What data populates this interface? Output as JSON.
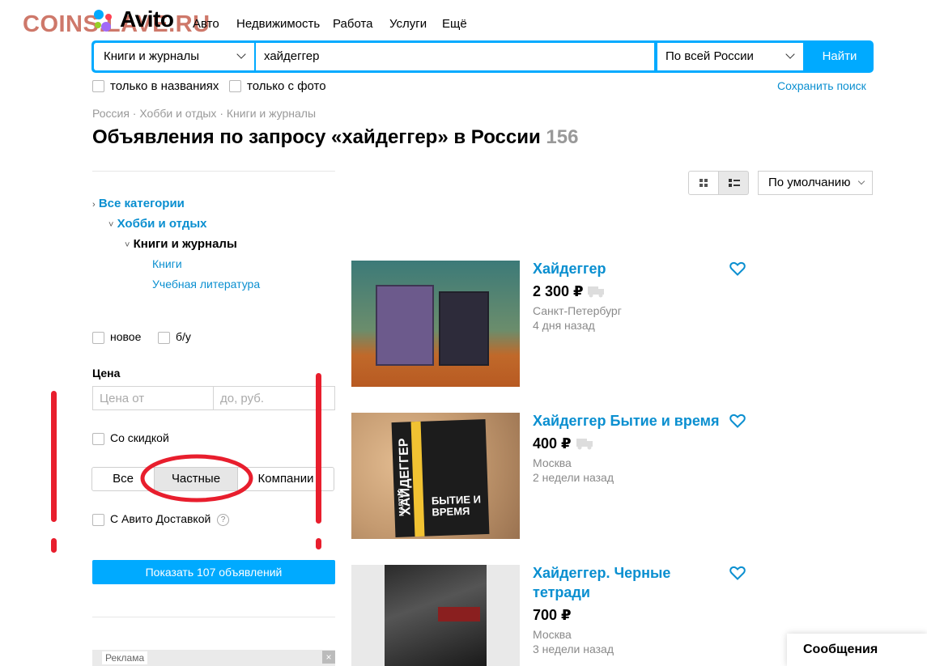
{
  "watermark": "COINS.LAVE.RU",
  "brand": {
    "name": "Avito"
  },
  "nav": [
    "Авто",
    "Недвижимость",
    "Работа",
    "Услуги",
    "Ещё"
  ],
  "search": {
    "category": "Книги и журналы",
    "query": "хайдеггер",
    "region": "По всей России",
    "button": "Найти"
  },
  "search_options": {
    "titles_only": "только в названиях",
    "with_photo": "только с фото",
    "save_search": "Сохранить поиск"
  },
  "breadcrumbs": "Россия · Хобби и отдых · Книги и журналы",
  "heading": {
    "text": "Объявления по запросу «хайдеггер» в России",
    "count": "156"
  },
  "categories": {
    "all": "Все категории",
    "hobby": "Хобби и отдых",
    "books": "Книги и журналы",
    "sub": [
      "Книги",
      "Учебная литература"
    ]
  },
  "filters": {
    "condition_new": "новое",
    "condition_used": "б/у",
    "price_label": "Цена",
    "price_from_placeholder": "Цена от",
    "price_to_placeholder": "до, руб.",
    "discount": "Со скидкой",
    "seller": {
      "all": "Все",
      "private": "Частные",
      "companies": "Компании"
    },
    "selected_seller": "private",
    "delivery": "С Авито Доставкой",
    "help_icon": "?",
    "show_button": "Показать 107 объявлений"
  },
  "sort": {
    "selected": "По умолчанию"
  },
  "listings": [
    {
      "title": "Хайдеггер",
      "price": "2 300 ₽",
      "city": "Санкт-Петербург",
      "date": "4 дня назад"
    },
    {
      "title": "Хайдеггер Бытие и время",
      "price": "400 ₽",
      "city": "Москва",
      "date": "2 недели назад"
    },
    {
      "title_line1": "Хайдеггер. Черные",
      "title_line2": "тетради",
      "price": "700 ₽",
      "city": "Москва",
      "date": "3 недели назад"
    }
  ],
  "book_cover_text": {
    "author": "МАРТИН",
    "surname": "ХАЙДЕГГЕР",
    "title": "БЫТИЕ И ВРЕМЯ"
  },
  "ad_label": "Реклама",
  "ad_close": "×",
  "messages": "Сообщения",
  "colors": {
    "accent": "#00aaff",
    "link": "#0a8fd0",
    "annotation": "#e81e2d"
  }
}
